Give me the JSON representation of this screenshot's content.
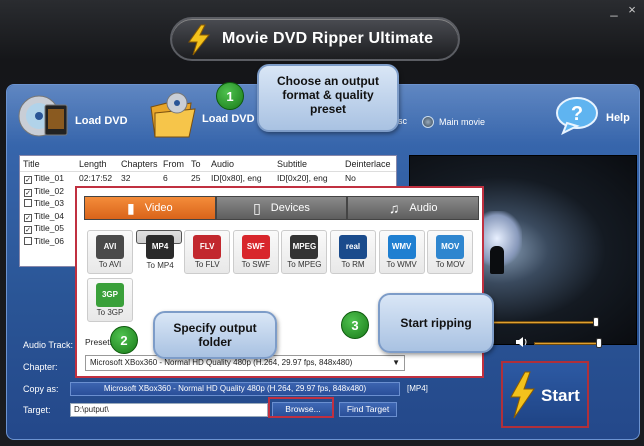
{
  "app": {
    "title": "Movie DVD Ripper Ultimate"
  },
  "window": {
    "minimize": "_",
    "close": "×"
  },
  "toolbar": {
    "load_dvd": "Load DVD",
    "load_dvd_folder": "Load DVD Folder",
    "entire_disc": "Entire disc",
    "main_movie": "Main movie",
    "help": "Help"
  },
  "table": {
    "headers": [
      "Title",
      "Length",
      "Chapters",
      "From",
      "To",
      "Audio",
      "Subtitle",
      "Deinterlace"
    ],
    "rows": [
      {
        "checked": true,
        "title": "Title_01",
        "length": "02:17:52",
        "chapters": "32",
        "from": "6",
        "to": "25",
        "audio": "ID[0x80], eng",
        "subtitle": "ID[0x20], eng",
        "deinterlace": "No"
      },
      {
        "checked": true,
        "title": "Title_02",
        "length": "",
        "chapters": "",
        "from": "",
        "to": "",
        "audio": "",
        "subtitle": "",
        "deinterlace": ""
      },
      {
        "checked": false,
        "title": "Title_03",
        "length": "",
        "chapters": "",
        "from": "",
        "to": "",
        "audio": "",
        "subtitle": "",
        "deinterlace": ""
      },
      {
        "checked": true,
        "title": "Title_04",
        "length": "",
        "chapters": "",
        "from": "",
        "to": "",
        "audio": "",
        "subtitle": "",
        "deinterlace": ""
      },
      {
        "checked": true,
        "title": "Title_05",
        "length": "",
        "chapters": "",
        "from": "",
        "to": "",
        "audio": "",
        "subtitle": "",
        "deinterlace": ""
      },
      {
        "checked": false,
        "title": "Title_06",
        "length": "",
        "chapters": "",
        "from": "",
        "to": "",
        "audio": "",
        "subtitle": "",
        "deinterlace": ""
      }
    ]
  },
  "format_dialog": {
    "tabs": [
      {
        "label": "Video",
        "icon": "film-icon",
        "active": true
      },
      {
        "label": "Devices",
        "icon": "phone-icon",
        "active": false
      },
      {
        "label": "Audio",
        "icon": "music-note-icon",
        "active": false
      }
    ],
    "formats": [
      {
        "label": "To AVI",
        "badge": "AVI",
        "color": "#4a4a4a"
      },
      {
        "label": "To MP4",
        "badge": "MP4",
        "color": "#2b2b2b",
        "selected": true
      },
      {
        "label": "To FLV",
        "badge": "FLV",
        "color": "#c2282e"
      },
      {
        "label": "To SWF",
        "badge": "SWF",
        "color": "#d8262c"
      },
      {
        "label": "To MPEG",
        "badge": "MPEG",
        "color": "#333333"
      },
      {
        "label": "To RM",
        "badge": "real",
        "color": "#1a4b8c"
      },
      {
        "label": "To WMV",
        "badge": "WMV",
        "color": "#1f7fd1"
      },
      {
        "label": "To MOV",
        "badge": "MOV",
        "color": "#2f86cf"
      },
      {
        "label": "To 3GP",
        "badge": "3GP",
        "color": "#3aa03a"
      }
    ],
    "presets_label": "Presets:",
    "preset_value": "Microsoft XBox360 - Normal HD Quality 480p (H.264, 29.97 fps, 848x480)"
  },
  "form": {
    "audio_track_label": "Audio Track:",
    "chapter_label": "Chapter:",
    "copy_as_label": "Copy as:",
    "copy_as_value": "Microsoft XBox360 - Normal HD Quality 480p (H.264, 29.97 fps, 848x480)",
    "copy_as_format": "[MP4]",
    "target_label": "Target:",
    "target_value": "D:\\putput\\",
    "browse": "Browse...",
    "find_target": "Find Target"
  },
  "callouts": {
    "step1_num": "1",
    "step1_text": "Choose an output format & quality preset",
    "step2_num": "2",
    "step2_text": "Specify output folder",
    "step3_num": "3",
    "step3_text": "Start ripping"
  },
  "start": {
    "label": "Start"
  },
  "volume": {
    "icon": "speaker-icon"
  }
}
